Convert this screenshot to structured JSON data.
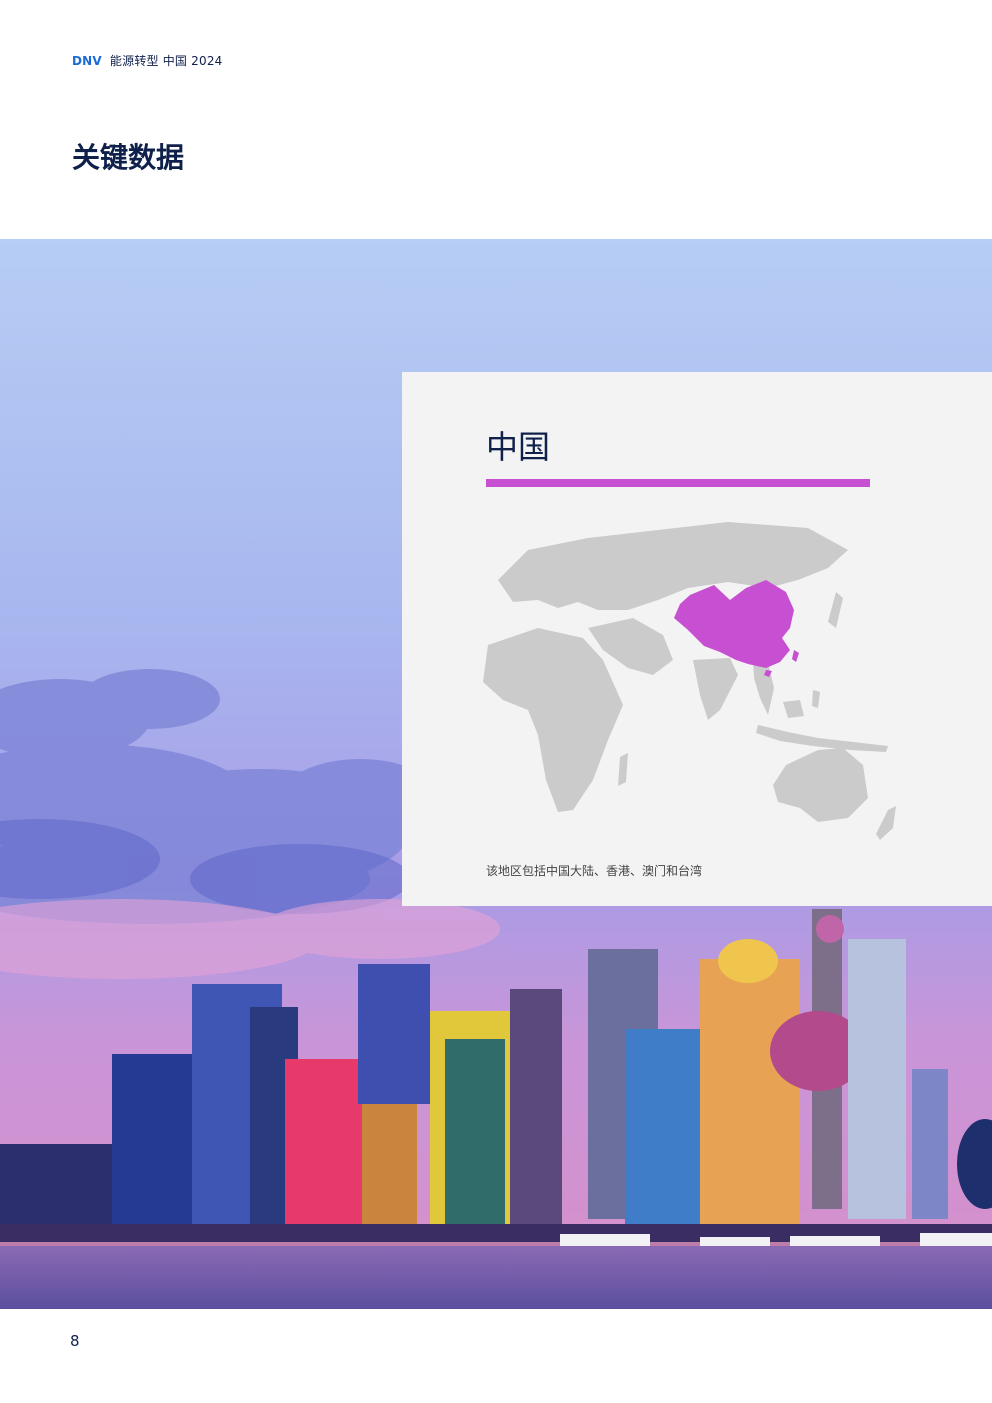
{
  "header": {
    "brand": "DNV",
    "report": "能源转型 中国 2024"
  },
  "page": {
    "title": "关键数据",
    "number": "8"
  },
  "card": {
    "region_name": "中国",
    "caption": "该地区包括中国大陆、香港、澳门和台湾"
  },
  "colors": {
    "accent": "#c64fd2",
    "navy": "#0f204b",
    "map_land": "#cbcbcb",
    "card_bg": "#f3f3f3"
  }
}
